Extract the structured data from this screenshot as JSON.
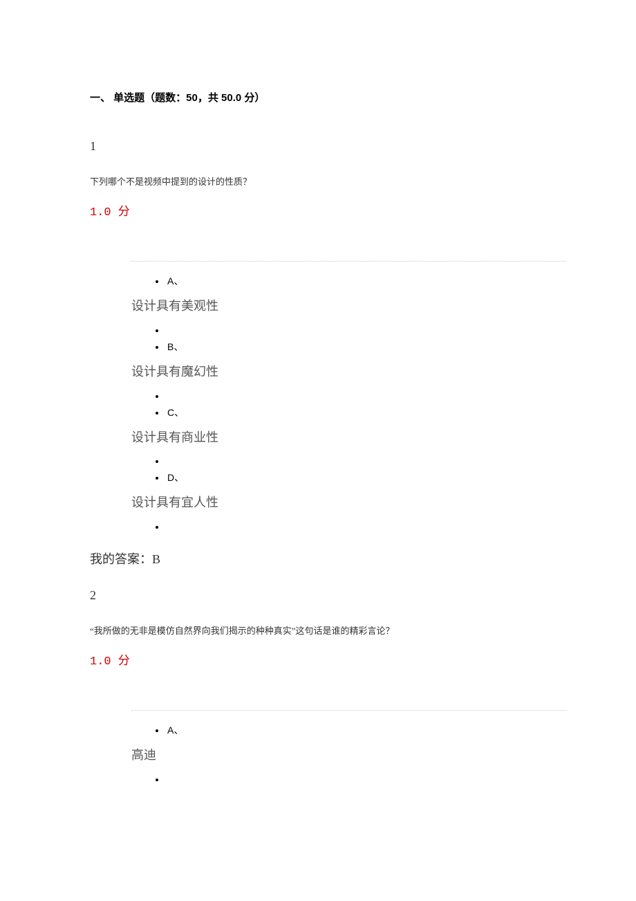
{
  "section": {
    "header": "一、 单选题（题数：50，共 50.0 分）"
  },
  "q1": {
    "number": "1",
    "text": "下列哪个不是视频中提到的设计的性质？",
    "score": "1.0 分",
    "options": {
      "a_label": "A、",
      "a_text": "设计具有美观性",
      "b_label": "B、",
      "b_text": "设计具有魔幻性",
      "c_label": "C、",
      "c_text": "设计具有商业性",
      "d_label": "D、",
      "d_text": "设计具有宜人性"
    },
    "answer": "我的答案：B"
  },
  "q2": {
    "number": "2",
    "text": "“我所做的无非是模仿自然界向我们揭示的种种真实”这句话是谁的精彩言论？",
    "score": "1.0 分",
    "options": {
      "a_label": "A、",
      "a_text": "高迪"
    }
  }
}
